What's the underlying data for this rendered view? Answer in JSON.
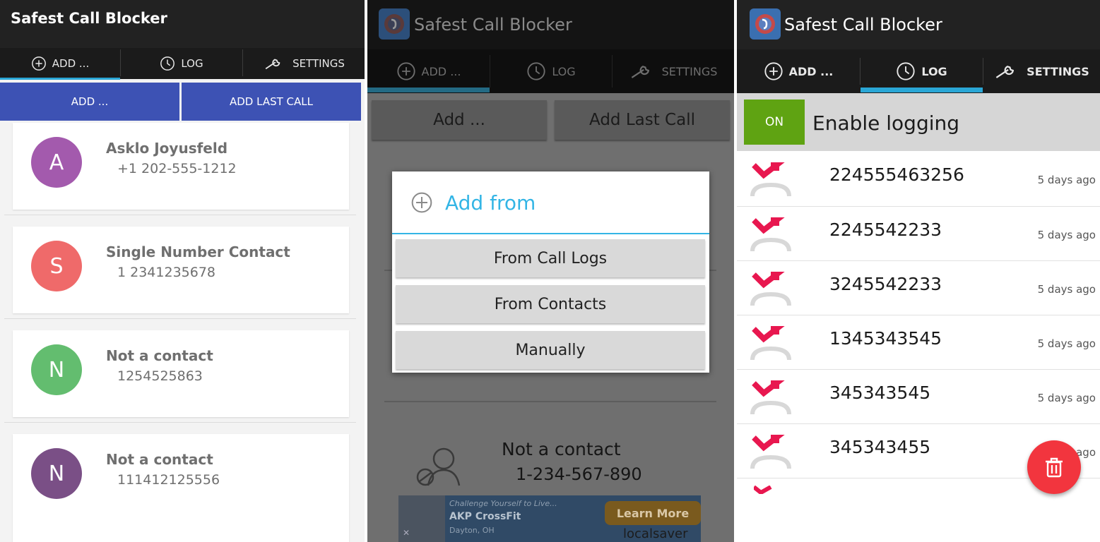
{
  "panel1": {
    "title": "Safest Call Blocker",
    "tabs": [
      {
        "label": "ADD ...",
        "icon": "add-circle-icon"
      },
      {
        "label": "LOG",
        "icon": "clock-icon"
      },
      {
        "label": "SETTINGS",
        "icon": "wrench-icon"
      }
    ],
    "buttons": {
      "add": "ADD ...",
      "add_last_call": "ADD LAST CALL"
    },
    "contacts": [
      {
        "initial": "A",
        "name": "Asklo Joyusfeld",
        "number": "+1 202-555-1212",
        "color": "#a35aad"
      },
      {
        "initial": "S",
        "name": "Single Number Contact",
        "number": "1 2341235678",
        "color": "#ef6a6a"
      },
      {
        "initial": "N",
        "name": "Not a contact",
        "number": "1254525863",
        "color": "#63bd6f"
      },
      {
        "initial": "N",
        "name": "Not a contact",
        "number": "111412125556",
        "color": "#7a4f86"
      }
    ],
    "accent": "#3d52b4"
  },
  "panel2": {
    "title": "Safest Call Blocker",
    "tabs": [
      {
        "label": "ADD ...",
        "icon": "add-circle-icon"
      },
      {
        "label": "LOG",
        "icon": "clock-icon"
      },
      {
        "label": "SETTINGS",
        "icon": "wrench-icon"
      }
    ],
    "buttons": {
      "add": "Add ...",
      "add_last_call": "Add Last Call"
    },
    "dialog": {
      "title": "Add from",
      "options": [
        "From Call Logs",
        "From Contacts",
        "Manually"
      ]
    },
    "contact": {
      "name": "Not a contact",
      "number": "1-234-567-890"
    },
    "ad": {
      "line1": "Challenge Yourself to Live...",
      "line2": "AKP CrossFit",
      "line3": "Dayton, OH",
      "cta": "Learn More",
      "brand": "localsaver",
      "close": "✕"
    }
  },
  "panel3": {
    "title": "Safest Call Blocker",
    "tabs": [
      {
        "label": "ADD ...",
        "icon": "add-circle-icon"
      },
      {
        "label": "LOG",
        "icon": "clock-icon"
      },
      {
        "label": "SETTINGS",
        "icon": "wrench-icon"
      }
    ],
    "logging": {
      "toggle": "ON",
      "label": "Enable logging",
      "toggle_color": "#5fa312"
    },
    "log": [
      {
        "number": "224555463256",
        "time": "5 days ago"
      },
      {
        "number": "2245542233",
        "time": "5 days ago"
      },
      {
        "number": "3245542233",
        "time": "5 days ago"
      },
      {
        "number": "1345343545",
        "time": "5 days ago"
      },
      {
        "number": "345343545",
        "time": "5 days ago"
      },
      {
        "number": "345343455",
        "time": "ago"
      }
    ],
    "fab_icon": "trash-icon",
    "fab_color": "#f2353e"
  }
}
